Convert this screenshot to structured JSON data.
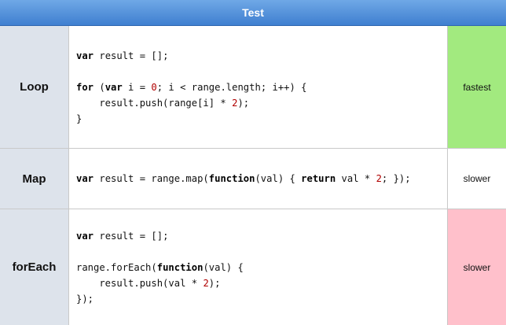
{
  "header": {
    "title": "Test"
  },
  "colors": {
    "fastest": "#a2ea7f",
    "slower_bad": "#ffc0cb",
    "slower_neutral": "#ffffff"
  },
  "rows": [
    {
      "label": "Loop",
      "code": {
        "l1_kw": "var",
        "l1_rest": " result = [];",
        "l3_kw1": "for",
        "l3_a": " (",
        "l3_kw2": "var",
        "l3_b": " i = ",
        "l3_num": "0",
        "l3_c": "; i < range.length; i++) {",
        "l4_a": "    result.push(range[i] * ",
        "l4_num": "2",
        "l4_b": ");",
        "l5": "}"
      },
      "result": "fastest"
    },
    {
      "label": "Map",
      "code": {
        "kw1": "var",
        "a": " result = range.map(",
        "kw2": "function",
        "b": "(val) { ",
        "kw3": "return",
        "c": " val * ",
        "num": "2",
        "d": "; });"
      },
      "result": "slower"
    },
    {
      "label": "forEach",
      "code": {
        "l1_kw": "var",
        "l1_rest": " result = [];",
        "l3_a": "range.forEach(",
        "l3_kw": "function",
        "l3_b": "(val) {",
        "l4_a": "    result.push(val * ",
        "l4_num": "2",
        "l4_b": ");",
        "l5": "});"
      },
      "result": "slower"
    }
  ]
}
